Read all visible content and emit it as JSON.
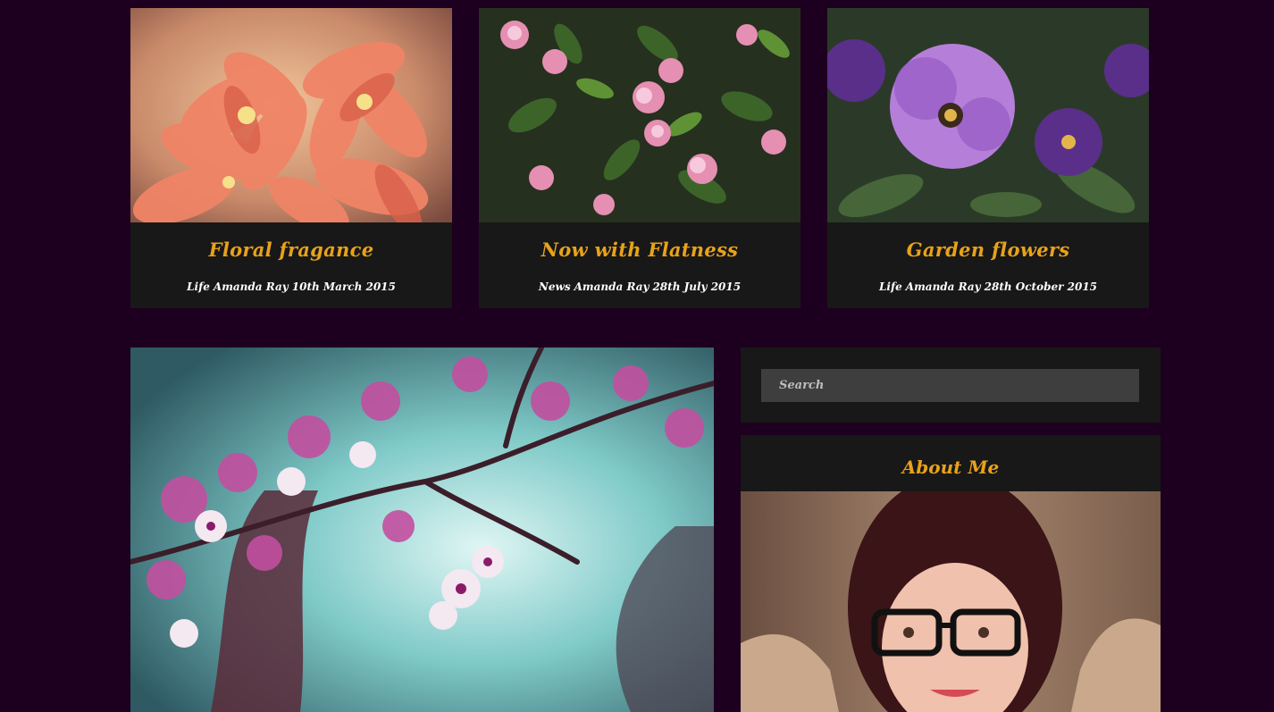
{
  "posts": [
    {
      "title": "Floral fragance",
      "category": "Life",
      "author": "Amanda Ray",
      "date": "10th March 2015",
      "image_icon": "coral-lily-photo"
    },
    {
      "title": "Now with Flatness",
      "category": "News",
      "author": "Amanda Ray",
      "date": "28th July 2015",
      "image_icon": "pink-blossom-photo"
    },
    {
      "title": "Garden flowers",
      "category": "Life",
      "author": "Amanda Ray",
      "date": "28th October 2015",
      "image_icon": "purple-petunia-photo"
    }
  ],
  "featured": {
    "image_icon": "cherry-blossom-photo"
  },
  "sidebar": {
    "search": {
      "placeholder": "Search",
      "value": ""
    },
    "about": {
      "title": "About Me",
      "image_icon": "portrait-photo"
    }
  },
  "colors": {
    "page_background": "#1d001f",
    "card_background": "#181818",
    "accent": "#e8a21a",
    "meta_text": "#ffffff",
    "search_field": "#3e3e3e"
  }
}
